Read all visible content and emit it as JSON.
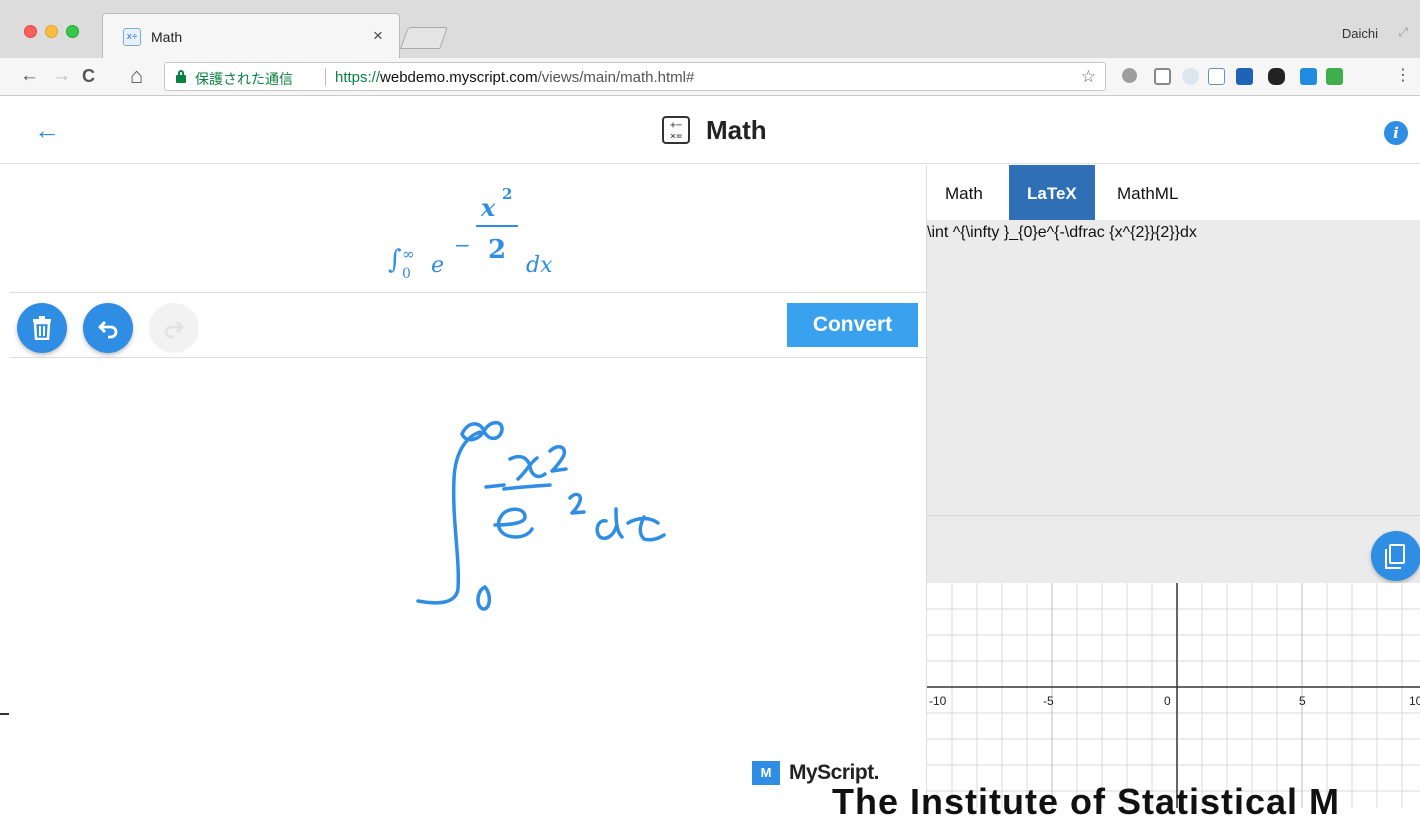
{
  "browser": {
    "tab_title": "Math",
    "tab_icon": "math-app-icon",
    "tab_icon_text": "x÷",
    "tab_close": "×",
    "profile_name": "Daichi",
    "secure_label": "保護された通信",
    "url_scheme": "https://",
    "url_host": "webdemo.myscript.com",
    "url_path": "/views/main/math.html#",
    "back": "←",
    "forward": "→",
    "reload": "C",
    "home": "⌂",
    "star": "☆",
    "menu": "⋮"
  },
  "app": {
    "title": "Math",
    "logo_text": "+−\n×=",
    "back_icon": "←",
    "info_icon": "i"
  },
  "result": {
    "integral": "∫",
    "upper": "∞",
    "lower": "0",
    "base": "e",
    "minus": "−",
    "numerator": "x",
    "numerator_exp": "2",
    "denominator": "2",
    "differential": "dx"
  },
  "edit_toolbar": {
    "delete_icon": "🗑",
    "undo_icon": "↶",
    "redo_icon": "↷",
    "convert_label": "Convert"
  },
  "panel": {
    "tabs": [
      {
        "label": "Math",
        "active": false
      },
      {
        "label": "LaTeX",
        "active": true
      },
      {
        "label": "MathML",
        "active": false
      }
    ],
    "latex": "\\int ^{\\infty }_{0}e^{-\\dfrac {x^{2}}{2}}dx"
  },
  "graph": {
    "x_ticks": [
      "-10",
      "-5",
      "0",
      "5",
      "10"
    ]
  },
  "brand": {
    "logo_text": "M",
    "name": "MyScript."
  },
  "overlay_text": "The Institute of Statistical M",
  "colors": {
    "accent": "#2f8de4",
    "tab_active": "#2f6fb5",
    "secure_green": "#0b8043"
  }
}
